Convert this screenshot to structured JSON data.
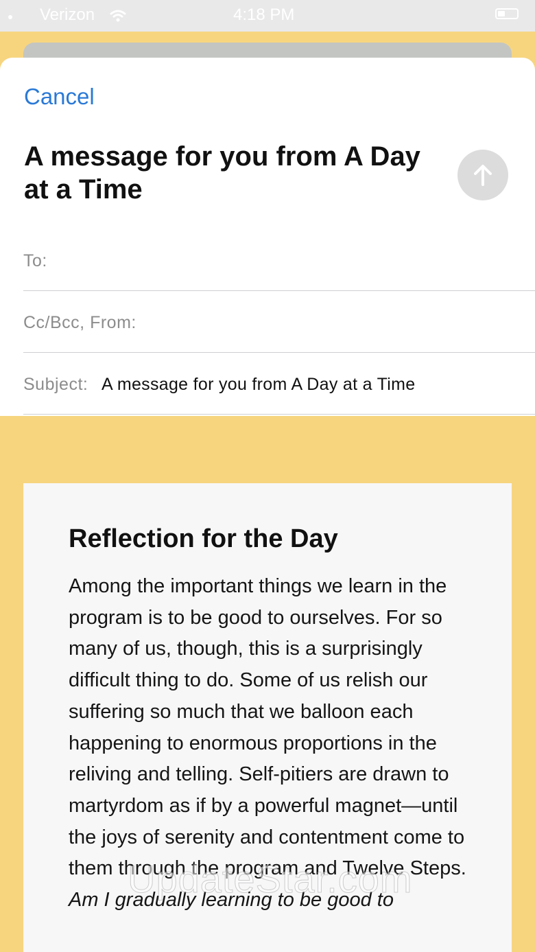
{
  "status_bar": {
    "carrier": "Verizon",
    "time": "4:18 PM"
  },
  "compose": {
    "cancel_label": "Cancel",
    "title": "A message for you from A Day at a Time",
    "to_label": "To:",
    "cc_bcc_from_label": "Cc/Bcc, From:",
    "subject_label": "Subject:",
    "subject_value": "A message for you from A Day at a Time"
  },
  "email_body": {
    "heading": "Reflection for the Day",
    "paragraph": "Among the important things we learn in the program is to be good to ourselves. For so many of us, though, this is a surprisingly difficult thing to do. Some of us relish our suffering so much that we balloon each happening to enormous proportions in the reliving and telling. Self-pitiers are drawn to martyrdom as if by a powerful magnet—until the joys of serenity and contentment come to them through the program and Twelve Steps.",
    "question": "Am I gradually learning to be good to"
  },
  "watermark": "UpdateStar.com",
  "colors": {
    "accent": "#2a79d6",
    "background": "#f7d57f",
    "send_button": "#dcdcdc"
  },
  "icons": {
    "send": "arrow-up-icon",
    "wifi": "wifi-icon",
    "battery": "battery-icon"
  }
}
